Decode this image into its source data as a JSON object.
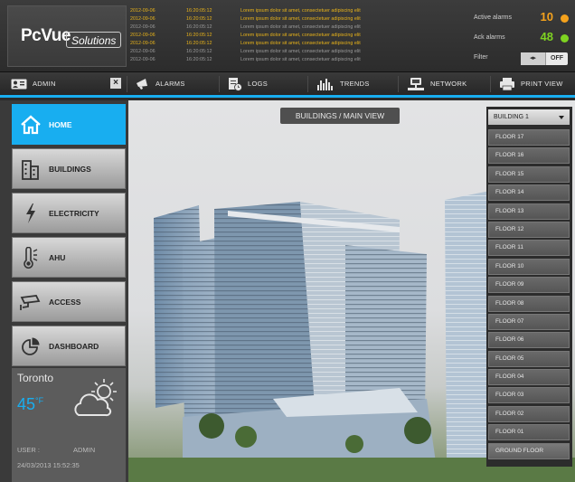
{
  "header": {
    "logo": {
      "brand": "PcVue",
      "suffix": "Solutions"
    },
    "alarm_log": [
      {
        "date": "2012-09-06",
        "time": "16:20:05:12",
        "message": "Lorem ipsum dolor sit amet, consectetuer adipiscing elit",
        "status": "active"
      },
      {
        "date": "2012-09-06",
        "time": "16:20:05:12",
        "message": "Lorem ipsum dolor sit amet, consectetuer adipiscing elit",
        "status": "active"
      },
      {
        "date": "2012-09-06",
        "time": "16:20:05:12",
        "message": "Lorem ipsum dolor sit amet, consectetuer adipiscing elit",
        "status": "inactive"
      },
      {
        "date": "2012-09-06",
        "time": "16:20:05:12",
        "message": "Lorem ipsum dolor sit amet, consectetuer adipiscing elit",
        "status": "active"
      },
      {
        "date": "2012-09-06",
        "time": "16:20:05:12",
        "message": "Lorem ipsum dolor sit amet, consectetuer adipiscing elit",
        "status": "active"
      },
      {
        "date": "2012-09-06",
        "time": "16:20:05:12",
        "message": "Lorem ipsum dolor sit amet, consectetuer adipiscing elit",
        "status": "inactive"
      },
      {
        "date": "2012-09-06",
        "time": "16:20:05:12",
        "message": "Lorem ipsum dolor sit amet, consectetuer adipiscing elit",
        "status": "inactive"
      }
    ],
    "alarm_summary": {
      "active_label": "Active alarms",
      "active_count": "10",
      "active_color": "#f5a21c",
      "ack_label": "Ack alarms",
      "ack_count": "48",
      "ack_color": "#7ed321",
      "filter_label": "Filter",
      "filter_state": "OFF"
    }
  },
  "toolbar": {
    "admin": {
      "label": "ADMIN",
      "close": "×",
      "icon": "user-card-icon"
    },
    "items": [
      {
        "label": "ALARMS",
        "icon": "megaphone-icon"
      },
      {
        "label": "LOGS",
        "icon": "document-clock-icon"
      },
      {
        "label": "TRENDS",
        "icon": "bar-chart-icon"
      },
      {
        "label": "NETWORK",
        "icon": "network-icon"
      },
      {
        "label": "PRINT VIEW",
        "icon": "printer-icon"
      }
    ],
    "accent_color": "#18aef0"
  },
  "sidebar": {
    "items": [
      {
        "label": "HOME",
        "icon": "home-icon",
        "active": true
      },
      {
        "label": "BUILDINGS",
        "icon": "building-icon",
        "active": false
      },
      {
        "label": "ELECTRICITY",
        "icon": "lightning-icon",
        "active": false
      },
      {
        "label": "AHU",
        "icon": "thermometer-icon",
        "active": false
      },
      {
        "label": "ACCESS",
        "icon": "camera-icon",
        "active": false
      },
      {
        "label": "DASHBOARD",
        "icon": "pie-chart-icon",
        "active": false
      }
    ],
    "weather": {
      "city": "Toronto",
      "temperature": "45",
      "unit": "°F",
      "icon": "partly-cloudy-icon",
      "user_label": "USER :",
      "user_name": "ADMIN",
      "datetime": "24/03/2013  15:52:35"
    }
  },
  "main": {
    "view_title": "BUILDINGS / MAIN VIEW"
  },
  "floor_panel": {
    "selected_building": "BUILDING 1",
    "floors": [
      "FLOOR 17",
      "FLOOR 16",
      "FLOOR 15",
      "FLOOR 14",
      "FLOOR 13",
      "FLOOR 12",
      "FLOOR 11",
      "FLOOR 10",
      "FLOOR 09",
      "FLOOR 08",
      "FLOOR 07",
      "FLOOR 06",
      "FLOOR 05",
      "FLOOR 04",
      "FLOOR 03",
      "FLOOR 02",
      "FLOOR 01",
      "GROUND FLOOR"
    ]
  }
}
